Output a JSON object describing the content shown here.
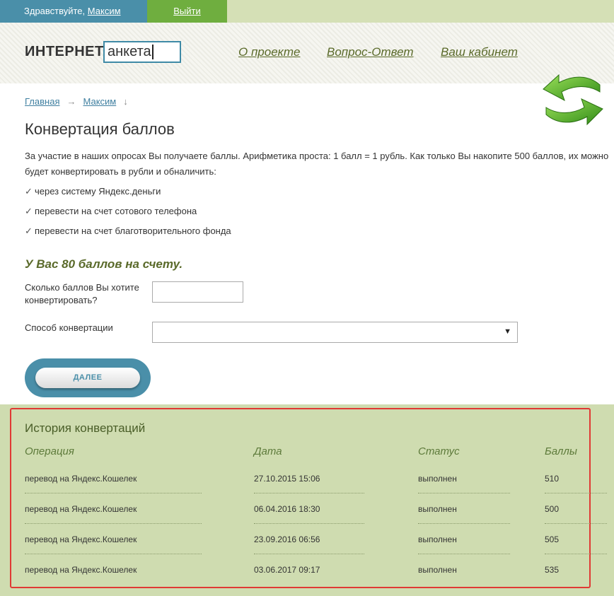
{
  "topbar": {
    "greeting": "Здравствуйте,",
    "user": "Максим",
    "logout": "Выйти"
  },
  "header": {
    "logo_word": "ИНТЕРНЕТ",
    "logo_box": "анкета",
    "nav": [
      "О проекте",
      "Вопрос-Ответ",
      "Ваш кабинет"
    ]
  },
  "breadcrumb": {
    "home": "Главная",
    "arrow": "→",
    "user": "Максим",
    "down": "↓"
  },
  "page_title": "Конвертация баллов",
  "intro": "За участие в наших опросах Вы получаете баллы. Арифметика проста: 1 балл = 1 рубль. Как только Вы накопите 500 баллов, их можно будет конвертировать в рубли и обналичить:",
  "methods_list": [
    "через систему Яндекс.деньги",
    "перевести на счет сотового телефона",
    "перевести на счет благотворительного фонда"
  ],
  "balance": "У Вас 80 баллов на счету.",
  "form": {
    "amount_label": "Сколько баллов Вы хотите конвертировать?",
    "amount_value": "",
    "method_label": "Способ конвертации",
    "method_value": "",
    "submit": "ДАЛЕЕ"
  },
  "history": {
    "title": "История конвертаций",
    "columns": [
      "Операция",
      "Дата",
      "Статус",
      "Баллы"
    ],
    "rows": [
      [
        "перевод на Яндекс.Кошелек",
        "27.10.2015 15:06",
        "выполнен",
        "510"
      ],
      [
        "перевод на Яндекс.Кошелек",
        "06.04.2016 18:30",
        "выполнен",
        "500"
      ],
      [
        "перевод на Яндекс.Кошелек",
        "23.09.2016 06:56",
        "выполнен",
        "505"
      ],
      [
        "перевод на Яндекс.Кошелек",
        "03.06.2017 09:17",
        "выполнен",
        "535"
      ]
    ]
  },
  "colors": {
    "blue": "#4a8fa9",
    "green": "#6fae3f",
    "olive": "#5a6a2a",
    "history_bg": "#cfdcb0",
    "highlight": "#e03a34"
  },
  "icons": {
    "refresh": "refresh-arrows-icon",
    "check": "check-icon",
    "dropdown": "triangle-down-icon"
  }
}
